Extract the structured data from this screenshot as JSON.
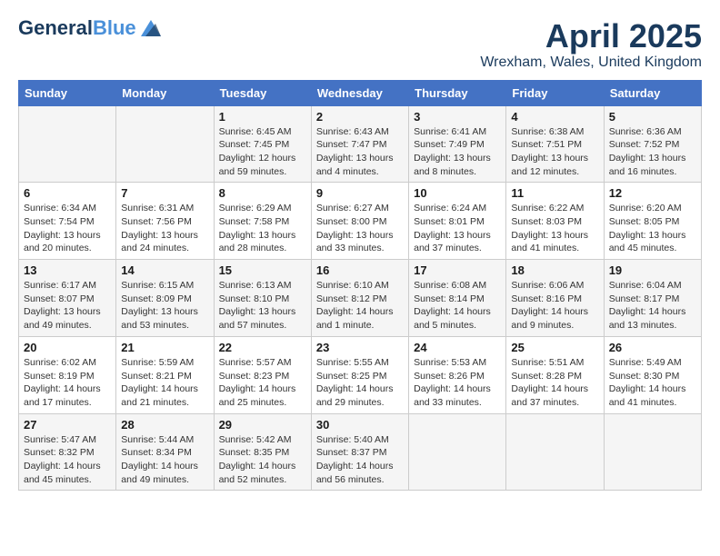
{
  "logo": {
    "general": "General",
    "blue": "Blue"
  },
  "title": "April 2025",
  "subtitle": "Wrexham, Wales, United Kingdom",
  "days_of_week": [
    "Sunday",
    "Monday",
    "Tuesday",
    "Wednesday",
    "Thursday",
    "Friday",
    "Saturday"
  ],
  "weeks": [
    [
      {
        "day": "",
        "sunrise": "",
        "sunset": "",
        "daylight": ""
      },
      {
        "day": "",
        "sunrise": "",
        "sunset": "",
        "daylight": ""
      },
      {
        "day": "1",
        "sunrise": "Sunrise: 6:45 AM",
        "sunset": "Sunset: 7:45 PM",
        "daylight": "Daylight: 12 hours and 59 minutes."
      },
      {
        "day": "2",
        "sunrise": "Sunrise: 6:43 AM",
        "sunset": "Sunset: 7:47 PM",
        "daylight": "Daylight: 13 hours and 4 minutes."
      },
      {
        "day": "3",
        "sunrise": "Sunrise: 6:41 AM",
        "sunset": "Sunset: 7:49 PM",
        "daylight": "Daylight: 13 hours and 8 minutes."
      },
      {
        "day": "4",
        "sunrise": "Sunrise: 6:38 AM",
        "sunset": "Sunset: 7:51 PM",
        "daylight": "Daylight: 13 hours and 12 minutes."
      },
      {
        "day": "5",
        "sunrise": "Sunrise: 6:36 AM",
        "sunset": "Sunset: 7:52 PM",
        "daylight": "Daylight: 13 hours and 16 minutes."
      }
    ],
    [
      {
        "day": "6",
        "sunrise": "Sunrise: 6:34 AM",
        "sunset": "Sunset: 7:54 PM",
        "daylight": "Daylight: 13 hours and 20 minutes."
      },
      {
        "day": "7",
        "sunrise": "Sunrise: 6:31 AM",
        "sunset": "Sunset: 7:56 PM",
        "daylight": "Daylight: 13 hours and 24 minutes."
      },
      {
        "day": "8",
        "sunrise": "Sunrise: 6:29 AM",
        "sunset": "Sunset: 7:58 PM",
        "daylight": "Daylight: 13 hours and 28 minutes."
      },
      {
        "day": "9",
        "sunrise": "Sunrise: 6:27 AM",
        "sunset": "Sunset: 8:00 PM",
        "daylight": "Daylight: 13 hours and 33 minutes."
      },
      {
        "day": "10",
        "sunrise": "Sunrise: 6:24 AM",
        "sunset": "Sunset: 8:01 PM",
        "daylight": "Daylight: 13 hours and 37 minutes."
      },
      {
        "day": "11",
        "sunrise": "Sunrise: 6:22 AM",
        "sunset": "Sunset: 8:03 PM",
        "daylight": "Daylight: 13 hours and 41 minutes."
      },
      {
        "day": "12",
        "sunrise": "Sunrise: 6:20 AM",
        "sunset": "Sunset: 8:05 PM",
        "daylight": "Daylight: 13 hours and 45 minutes."
      }
    ],
    [
      {
        "day": "13",
        "sunrise": "Sunrise: 6:17 AM",
        "sunset": "Sunset: 8:07 PM",
        "daylight": "Daylight: 13 hours and 49 minutes."
      },
      {
        "day": "14",
        "sunrise": "Sunrise: 6:15 AM",
        "sunset": "Sunset: 8:09 PM",
        "daylight": "Daylight: 13 hours and 53 minutes."
      },
      {
        "day": "15",
        "sunrise": "Sunrise: 6:13 AM",
        "sunset": "Sunset: 8:10 PM",
        "daylight": "Daylight: 13 hours and 57 minutes."
      },
      {
        "day": "16",
        "sunrise": "Sunrise: 6:10 AM",
        "sunset": "Sunset: 8:12 PM",
        "daylight": "Daylight: 14 hours and 1 minute."
      },
      {
        "day": "17",
        "sunrise": "Sunrise: 6:08 AM",
        "sunset": "Sunset: 8:14 PM",
        "daylight": "Daylight: 14 hours and 5 minutes."
      },
      {
        "day": "18",
        "sunrise": "Sunrise: 6:06 AM",
        "sunset": "Sunset: 8:16 PM",
        "daylight": "Daylight: 14 hours and 9 minutes."
      },
      {
        "day": "19",
        "sunrise": "Sunrise: 6:04 AM",
        "sunset": "Sunset: 8:17 PM",
        "daylight": "Daylight: 14 hours and 13 minutes."
      }
    ],
    [
      {
        "day": "20",
        "sunrise": "Sunrise: 6:02 AM",
        "sunset": "Sunset: 8:19 PM",
        "daylight": "Daylight: 14 hours and 17 minutes."
      },
      {
        "day": "21",
        "sunrise": "Sunrise: 5:59 AM",
        "sunset": "Sunset: 8:21 PM",
        "daylight": "Daylight: 14 hours and 21 minutes."
      },
      {
        "day": "22",
        "sunrise": "Sunrise: 5:57 AM",
        "sunset": "Sunset: 8:23 PM",
        "daylight": "Daylight: 14 hours and 25 minutes."
      },
      {
        "day": "23",
        "sunrise": "Sunrise: 5:55 AM",
        "sunset": "Sunset: 8:25 PM",
        "daylight": "Daylight: 14 hours and 29 minutes."
      },
      {
        "day": "24",
        "sunrise": "Sunrise: 5:53 AM",
        "sunset": "Sunset: 8:26 PM",
        "daylight": "Daylight: 14 hours and 33 minutes."
      },
      {
        "day": "25",
        "sunrise": "Sunrise: 5:51 AM",
        "sunset": "Sunset: 8:28 PM",
        "daylight": "Daylight: 14 hours and 37 minutes."
      },
      {
        "day": "26",
        "sunrise": "Sunrise: 5:49 AM",
        "sunset": "Sunset: 8:30 PM",
        "daylight": "Daylight: 14 hours and 41 minutes."
      }
    ],
    [
      {
        "day": "27",
        "sunrise": "Sunrise: 5:47 AM",
        "sunset": "Sunset: 8:32 PM",
        "daylight": "Daylight: 14 hours and 45 minutes."
      },
      {
        "day": "28",
        "sunrise": "Sunrise: 5:44 AM",
        "sunset": "Sunset: 8:34 PM",
        "daylight": "Daylight: 14 hours and 49 minutes."
      },
      {
        "day": "29",
        "sunrise": "Sunrise: 5:42 AM",
        "sunset": "Sunset: 8:35 PM",
        "daylight": "Daylight: 14 hours and 52 minutes."
      },
      {
        "day": "30",
        "sunrise": "Sunrise: 5:40 AM",
        "sunset": "Sunset: 8:37 PM",
        "daylight": "Daylight: 14 hours and 56 minutes."
      },
      {
        "day": "",
        "sunrise": "",
        "sunset": "",
        "daylight": ""
      },
      {
        "day": "",
        "sunrise": "",
        "sunset": "",
        "daylight": ""
      },
      {
        "day": "",
        "sunrise": "",
        "sunset": "",
        "daylight": ""
      }
    ]
  ]
}
